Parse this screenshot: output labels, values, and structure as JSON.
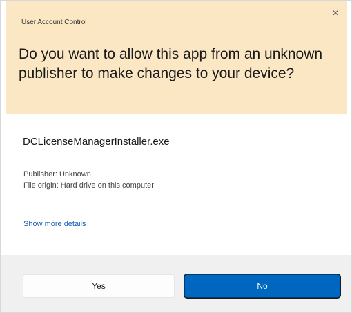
{
  "dialog": {
    "app_label": "User Account Control",
    "close_glyph": "×",
    "question": "Do you want to allow this app from an unknown publisher to make changes to your device?",
    "filename": "DCLicenseManagerInstaller.exe",
    "publisher": "Publisher: Unknown",
    "origin": "File origin: Hard drive on this computer",
    "details_link": "Show more details",
    "buttons": {
      "yes": "Yes",
      "no": "No"
    }
  },
  "colors": {
    "header_bg": "#fbe7c3",
    "primary_button": "#0067c0",
    "link": "#1e5fb3"
  }
}
